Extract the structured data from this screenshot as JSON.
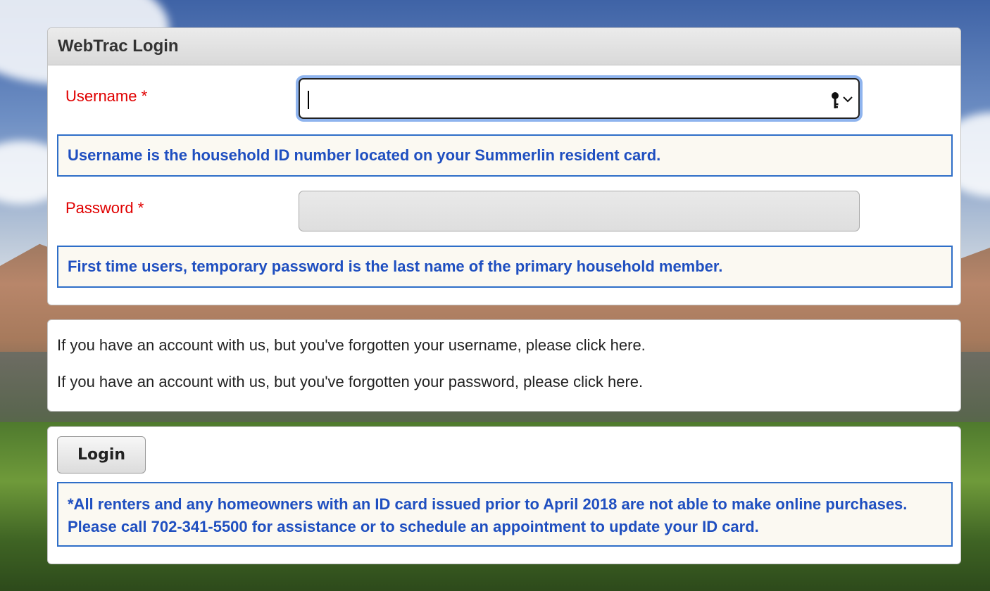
{
  "login_panel": {
    "title": "WebTrac Login",
    "username": {
      "label": "Username *",
      "value": "",
      "hint": "Username is the household ID number located on your Summerlin resident card."
    },
    "password": {
      "label": "Password *",
      "value": "",
      "hint": "First time users, temporary password is the last name of the primary household member."
    }
  },
  "forgot_panel": {
    "username_text": "If you have an account with us, but you've forgotten your username, please click here.",
    "password_text": "If you have an account with us, but you've forgotten your password, please click here."
  },
  "actions_panel": {
    "login_label": "Login",
    "notice": "*All renters and any homeowners with an ID card issued prior to April 2018 are not able to make online purchases. Please call 702-341-5500 for assistance or to schedule an appointment to update your ID card."
  },
  "icons": {
    "username_autofill": "key-icon",
    "username_dropdown": "chevron-down-icon"
  },
  "colors": {
    "required_label": "#e00000",
    "info_text": "#1f4fc0",
    "info_border": "#2e6ec8",
    "focus_ring": "#8fb4ee"
  }
}
